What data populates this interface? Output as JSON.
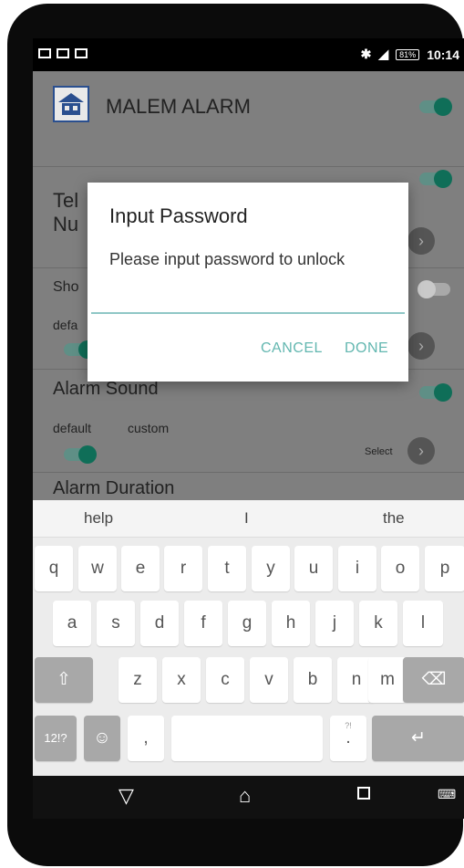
{
  "status_bar": {
    "time": "10:14",
    "battery": "81%"
  },
  "app": {
    "title": "MALEM ALARM"
  },
  "settings": {
    "tele_label_line1": "Tel",
    "tele_label_line2": "Nu",
    "show_label": "Sho",
    "show_default_label": "defa",
    "alarm_sound_label": "Alarm Sound",
    "alarm_sound_default": "default",
    "alarm_sound_custom": "custom",
    "alarm_sound_select": "Select",
    "alarm_duration_label": "Alarm Duration"
  },
  "dialog": {
    "title": "Input Password",
    "message": "Please input password to unlock",
    "input_value": "",
    "cancel_label": "CANCEL",
    "done_label": "DONE"
  },
  "keyboard": {
    "suggestions": [
      "help",
      "I",
      "the"
    ],
    "row1": [
      "q",
      "w",
      "e",
      "r",
      "t",
      "y",
      "u",
      "i",
      "o",
      "p"
    ],
    "row2": [
      "a",
      "s",
      "d",
      "f",
      "g",
      "h",
      "j",
      "k",
      "l"
    ],
    "row3": [
      "z",
      "x",
      "c",
      "v",
      "b",
      "n",
      "m"
    ],
    "shift_label": "⇧",
    "backspace_label": "⌫",
    "symbols_label": "12!?",
    "emoji_label": "☺",
    "comma_label": ",",
    "period_label": ".",
    "period_hint": "?!",
    "enter_label": "↵"
  },
  "nav": {
    "back_icon": "back-triangle",
    "home_icon": "home",
    "recents_icon": "recents-square",
    "keyboard_icon": "keyboard"
  },
  "colors": {
    "accent": "#63b7b0",
    "toggle_on": "#0f6e58",
    "dim_overlay": "#7f7f7f"
  }
}
